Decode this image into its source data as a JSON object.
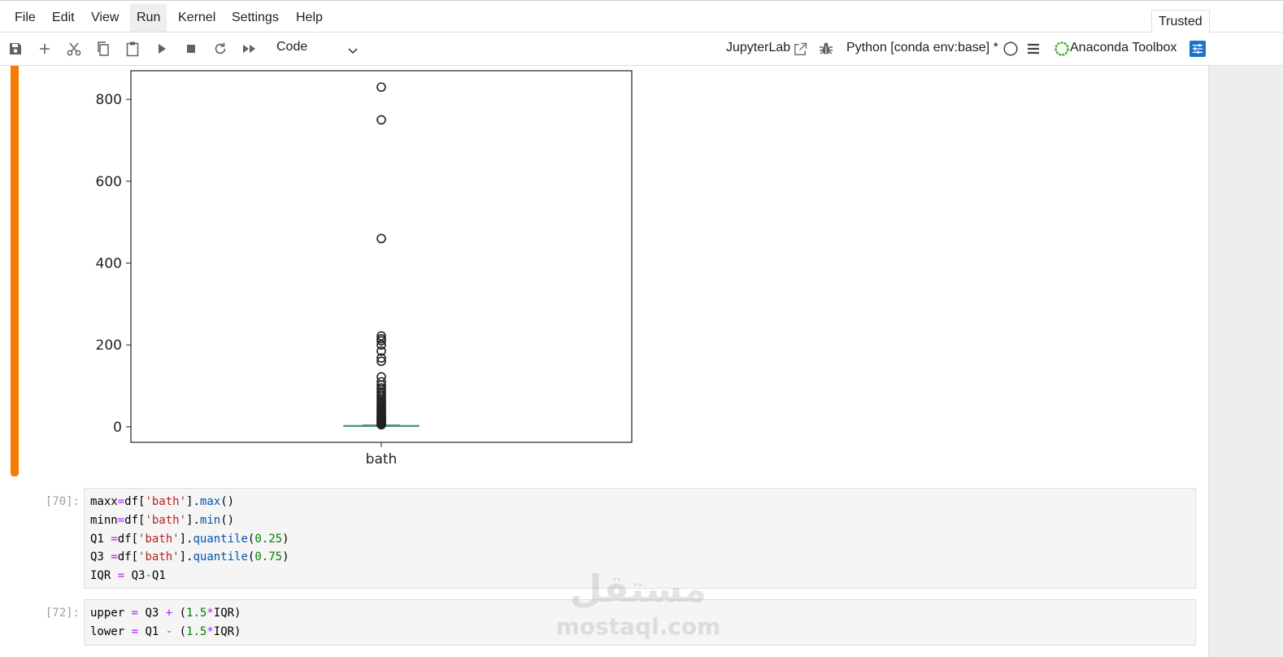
{
  "menubar": {
    "items": [
      "File",
      "Edit",
      "View",
      "Run",
      "Kernel",
      "Settings",
      "Help"
    ],
    "active": "Run",
    "trusted_label": "Trusted"
  },
  "toolbar": {
    "cell_type": "Code",
    "jupyterlab_label": "JupyterLab",
    "kernel_label": "Python [conda env:base] *",
    "anaconda_label": "Anaconda Toolbox",
    "icons": [
      "save-icon",
      "add-icon",
      "scissors-icon",
      "copy-icon",
      "paste-icon",
      "run-icon",
      "stop-icon",
      "restart-icon",
      "fast-forward-icon",
      "chevron-down-icon",
      "external-link-icon",
      "bug-icon",
      "kernel-idle-circle-icon",
      "menu-icon",
      "anaconda-ring-icon",
      "settings-sliders-icon"
    ],
    "accent_color": "#1a73c8"
  },
  "chart_data": {
    "type": "box",
    "categories": [
      "bath"
    ],
    "yticks": [
      0,
      200,
      400,
      600,
      800
    ],
    "ylim": [
      -38,
      870
    ],
    "box": {
      "q1": 2,
      "median": 2,
      "q3": 3,
      "whisker_low": 1,
      "whisker_high": 4
    },
    "outliers": [
      830,
      750,
      460,
      222,
      215,
      210,
      200,
      185,
      168,
      160,
      122,
      110,
      102,
      95,
      90,
      85,
      80,
      75,
      70,
      66,
      62,
      58,
      54,
      50,
      47,
      44,
      41,
      38,
      35,
      32,
      30,
      28,
      26,
      24,
      22,
      20,
      18,
      16,
      14,
      12,
      11,
      10,
      9,
      8,
      7,
      6,
      5
    ],
    "median_color": "#3ca27a",
    "grid": false
  },
  "cells": [
    {
      "prompt": "[70]:",
      "lines": [
        [
          [
            "",
            "maxx"
          ],
          [
            "op",
            "="
          ],
          [
            "",
            "df["
          ],
          [
            "str",
            "'bath'"
          ],
          [
            "",
            "]."
          ],
          [
            "fn",
            "max"
          ],
          [
            "",
            "()"
          ]
        ],
        [
          [
            "",
            "minn"
          ],
          [
            "op",
            "="
          ],
          [
            "",
            "df["
          ],
          [
            "str",
            "'bath'"
          ],
          [
            "",
            "]."
          ],
          [
            "fn",
            "min"
          ],
          [
            "",
            "()"
          ]
        ],
        [
          [
            "",
            "Q1 "
          ],
          [
            "op",
            "="
          ],
          [
            "",
            "df["
          ],
          [
            "str",
            "'bath'"
          ],
          [
            "",
            "]."
          ],
          [
            "fn",
            "quantile"
          ],
          [
            "",
            "("
          ],
          [
            "num",
            "0.25"
          ],
          [
            "",
            ")"
          ]
        ],
        [
          [
            "",
            "Q3 "
          ],
          [
            "op",
            "="
          ],
          [
            "",
            "df["
          ],
          [
            "str",
            "'bath'"
          ],
          [
            "",
            "]."
          ],
          [
            "fn",
            "quantile"
          ],
          [
            "",
            "("
          ],
          [
            "num",
            "0.75"
          ],
          [
            "",
            ")"
          ]
        ],
        [
          [
            "",
            "IQR "
          ],
          [
            "op",
            "="
          ],
          [
            "",
            " Q3"
          ],
          [
            "op",
            "-"
          ],
          [
            "",
            "Q1"
          ]
        ]
      ]
    },
    {
      "prompt": "[72]:",
      "lines": [
        [
          [
            "",
            "upper "
          ],
          [
            "op",
            "="
          ],
          [
            "",
            " Q3 "
          ],
          [
            "op",
            "+"
          ],
          [
            "",
            " ("
          ],
          [
            "num",
            "1.5"
          ],
          [
            "op",
            "*"
          ],
          [
            "",
            "IQR)"
          ]
        ],
        [
          [
            "",
            "lower "
          ],
          [
            "op",
            "="
          ],
          [
            "",
            " Q1 "
          ],
          [
            "op",
            "-"
          ],
          [
            "",
            " ("
          ],
          [
            "num",
            "1.5"
          ],
          [
            "op",
            "*"
          ],
          [
            "",
            "IQR)"
          ]
        ]
      ]
    }
  ],
  "watermark": {
    "arabic": "مستقل",
    "latin": "mostaql.com"
  }
}
